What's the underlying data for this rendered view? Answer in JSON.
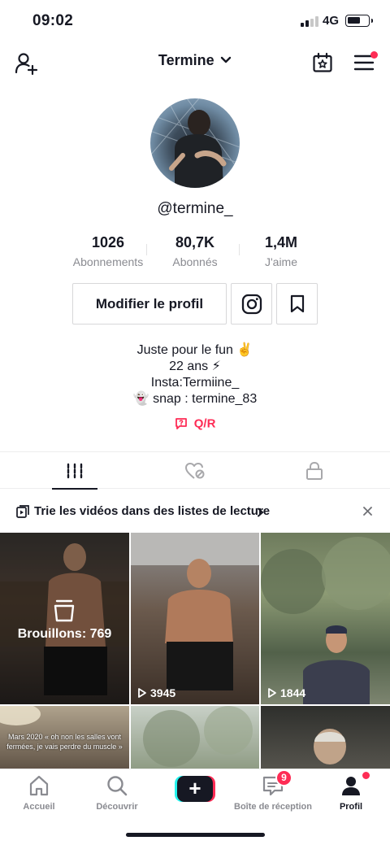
{
  "status_bar": {
    "time": "09:02",
    "network": "4G",
    "battery_level": 0.62
  },
  "header": {
    "title": "Termine"
  },
  "profile": {
    "username": "@termine_",
    "stats": [
      {
        "value": "1026",
        "label": "Abonnements"
      },
      {
        "value": "80,7K",
        "label": "Abonnés"
      },
      {
        "value": "1,4M",
        "label": "J'aime"
      }
    ],
    "edit_button": "Modifier le profil",
    "bio": [
      "Juste pour le fun ✌️",
      "22 ans ⚡",
      "Insta:Termiine_",
      "👻 snap : termine_83"
    ],
    "qr_label": "Q/R"
  },
  "tabs": [
    "videos-grid-icon",
    "liked-hidden-icon",
    "lock-icon"
  ],
  "banner": {
    "text": "Trie les vidéos dans des listes de lecture"
  },
  "videos": {
    "drafts_label": "Brouillons: 769",
    "views": [
      "3945",
      "1844"
    ],
    "caption": "Mars 2020 « oh non les salles vont fermées, je vais perdre du muscle »"
  },
  "nav": {
    "items": [
      "Accueil",
      "Découvrir",
      "Boîte de réception",
      "Profil"
    ],
    "inbox_badge": "9"
  },
  "colors": {
    "accent": "#fe2c55",
    "text": "#161823",
    "muted": "#8a8b91",
    "cyan": "#25f4ee"
  }
}
